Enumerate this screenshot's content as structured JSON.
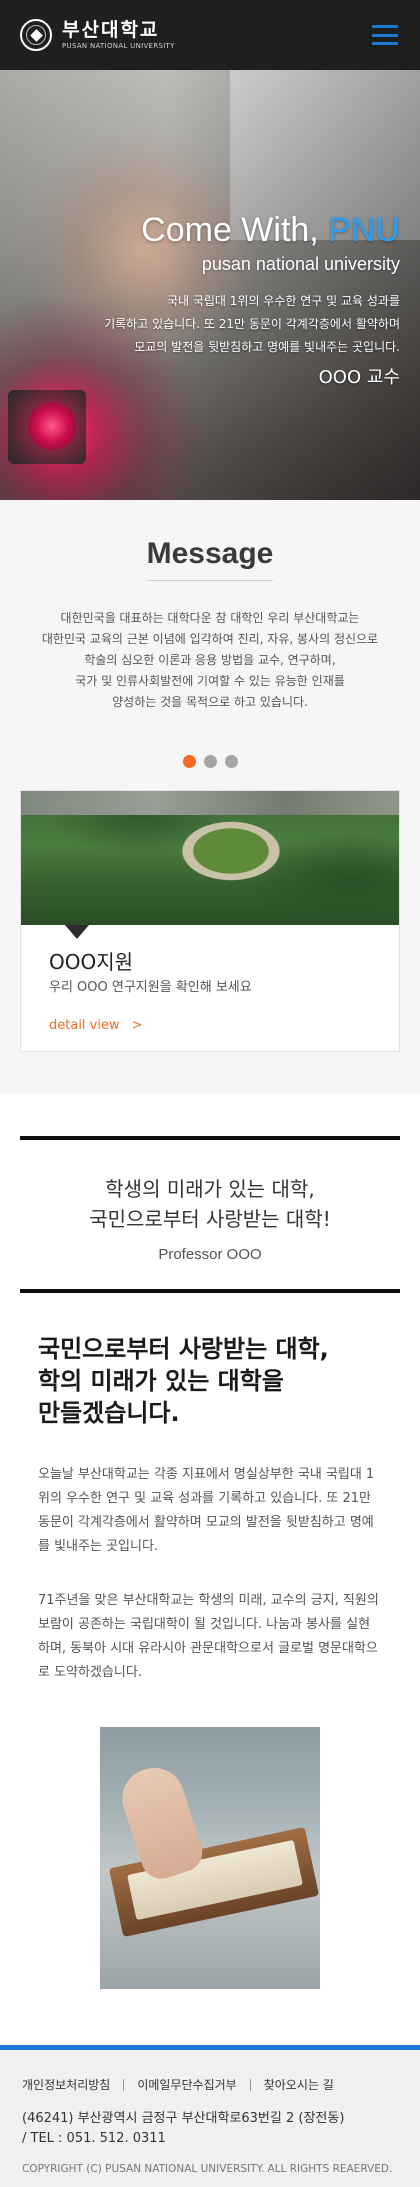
{
  "header": {
    "logo_name_ko": "부산대학교",
    "logo_name_en": "PUSAN NATIONAL UNIVERSITY",
    "menu_icon": "hamburger-menu-icon",
    "accent_color": "#1e7ad6"
  },
  "hero": {
    "title_prefix": "Come With, ",
    "title_accent": "PNU",
    "subtitle": "pusan national university",
    "desc_line1": "국내 국립대 1위의 우수한 연구 및 교육 성과를",
    "desc_line2": "기록하고 있습니다. 또 21만 동문이 각계각층에서 활약하며",
    "desc_line3": "모교의 발전을 뒷받침하고 명예를 빛내주는 곳입니다.",
    "author": "OOO 교수"
  },
  "message": {
    "title": "Message",
    "body_line1": "대한민국을 대표하는 대학다운 참 대학인 우리 부산대학교는",
    "body_line2": "대한민국 교육의 근본 이념에 입각하여 진리, 자유, 봉사의 정신으로",
    "body_line3": "학술의 심오한 이론과 응용 방법을 교수, 연구하며,",
    "body_line4": "국가 및 인류사회발전에 기여할 수 있는 유능한 인재를",
    "body_line5": "양성하는 것을 목적으로 하고 있습니다.",
    "active_dot_color": "#f36c21",
    "card": {
      "title": "OOO지원",
      "description": "우리 OOO 연구지원을 확인해 보세요",
      "link_label": "detail view",
      "link_arrow": ">"
    }
  },
  "quote": {
    "line1": "학생의 미래가 있는 대학,",
    "line2": "국민으로부터 사랑받는 대학!",
    "author": "Professor OOO"
  },
  "article": {
    "heading_line1": "국민으로부터 사랑받는 대학,",
    "heading_line2": "학의 미래가 있는 대학을",
    "heading_line3": "만들겠습니다.",
    "para1": "오늘날 부산대학교는 각종 지표에서 명실상부한 국내 국립대 1위의 우수한 연구 및 교육 성과를 기록하고 있습니다. 또 21만 동문이 각계각층에서 활약하며 모교의 발전을 뒷받침하고 명예를 빛내주는 곳입니다.",
    "para2": "71주년을 맞은 부산대학교는 학생의 미래, 교수의 긍지, 직원의 보람이 공존하는 국립대학이 될 것입니다. 나눔과 봉사를 실현하며, 동북아 시대 유라시아 관문대학으로서 글로벌 명문대학으로 도약하겠습니다."
  },
  "footer": {
    "link1": "개인정보처리방침",
    "link2": "이메일무단수집거부",
    "link3": "찾아오시는 길",
    "address_line1": "(46241) 부산광역시 금정구 부산대학로63번길 2 (장전동)",
    "address_line2": "/ TEL : 051. 512. 0311",
    "copyright": "COPYRIGHT (C) PUSAN NATIONAL UNIVERSITY.  ALL RIGHTS REAERVED."
  }
}
